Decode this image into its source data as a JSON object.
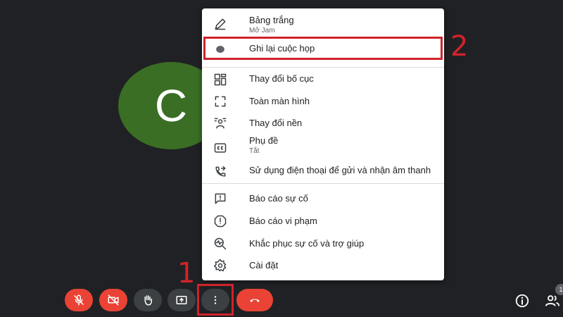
{
  "avatar": {
    "initial": "C",
    "color": "#3a6e25"
  },
  "menu": {
    "items": [
      {
        "label": "Bảng trắng",
        "sublabel": "Mở Jam",
        "icon": "pen-icon"
      },
      {
        "label": "Ghi lại cuộc họp",
        "icon": "record-dot-icon"
      },
      {
        "label": "Thay đổi bố cục",
        "icon": "layout-icon"
      },
      {
        "label": "Toàn màn hình",
        "icon": "fullscreen-icon"
      },
      {
        "label": "Thay đổi nền",
        "icon": "background-icon"
      },
      {
        "label": "Phụ đề",
        "sublabel": "Tắt",
        "icon": "captions-icon"
      },
      {
        "label": "Sử dụng điện thoại để gửi và nhận âm thanh",
        "icon": "phone-forward-icon"
      },
      {
        "label": "Báo cáo sự cố",
        "icon": "feedback-icon"
      },
      {
        "label": "Báo cáo vi phạm",
        "icon": "report-icon"
      },
      {
        "label": "Khắc phục sự cố và trợ giúp",
        "icon": "troubleshoot-icon"
      },
      {
        "label": "Cài đặt",
        "icon": "gear-icon"
      }
    ]
  },
  "annotations": {
    "step1": "1",
    "step2": "2",
    "color": "#d0232b"
  },
  "controls": {
    "mic": "mic-off-icon",
    "camera": "camera-off-icon",
    "hand": "raise-hand-icon",
    "present": "present-screen-icon",
    "more": "more-vert-icon",
    "hangup": "hang-up-icon"
  },
  "people_count": "1",
  "colors": {
    "background": "#202124",
    "red": "#ea4335",
    "dark_button": "#3c4043",
    "menu_bg": "#ffffff"
  }
}
